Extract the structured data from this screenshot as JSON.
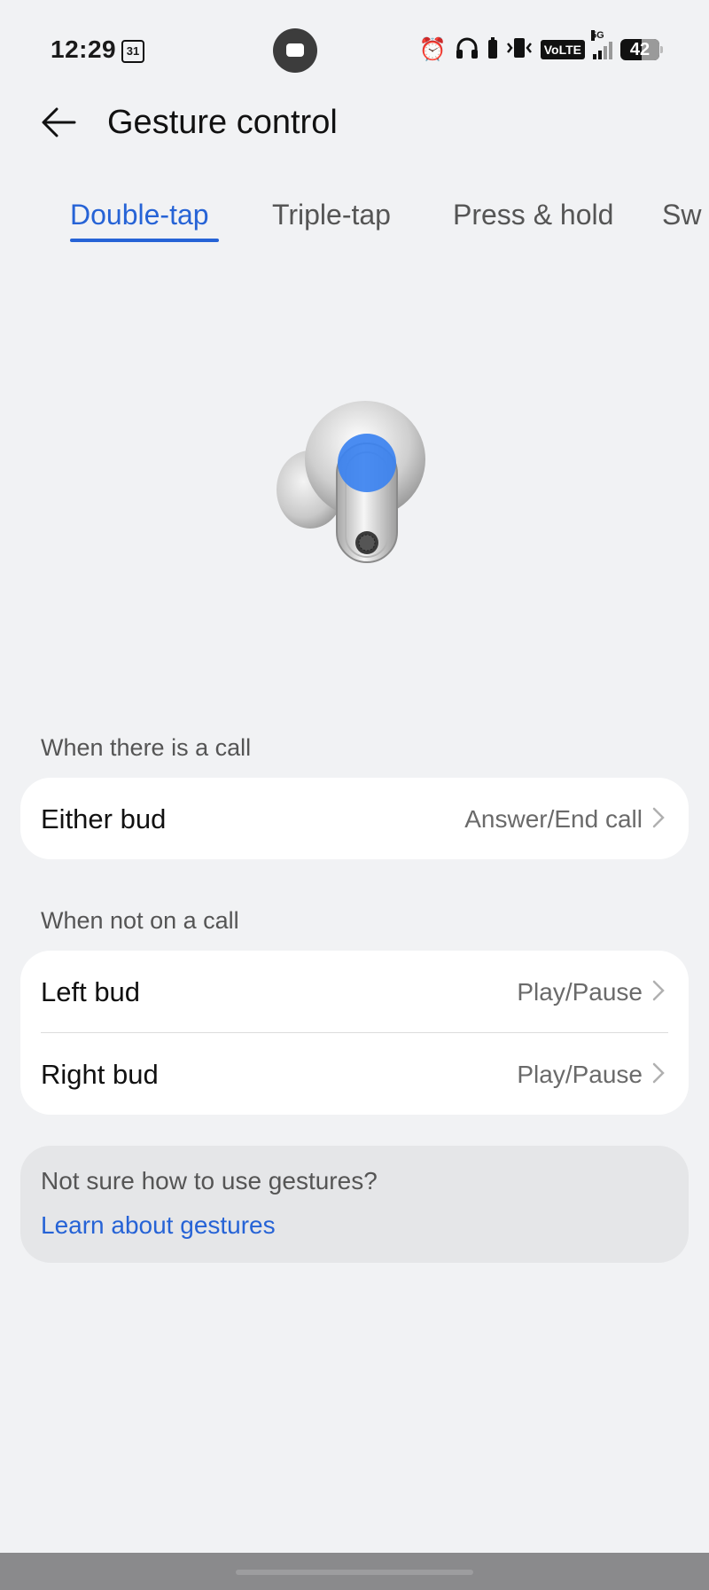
{
  "status_bar": {
    "time": "12:29",
    "calendar_day": "31",
    "network": "5G",
    "volte": "VoLTE",
    "battery": "42",
    "icons": [
      "alarm-icon",
      "headphones-icon",
      "vibrate-icon",
      "volte-icon",
      "signal-icon",
      "battery-icon"
    ]
  },
  "header": {
    "title": "Gesture control"
  },
  "tabs": [
    {
      "label": "Double-tap",
      "active": true
    },
    {
      "label": "Triple-tap",
      "active": false
    },
    {
      "label": "Press & hold",
      "active": false
    },
    {
      "label": "Sw",
      "active": false
    }
  ],
  "sections": {
    "call": {
      "label": "When there is a call",
      "rows": [
        {
          "label": "Either bud",
          "value": "Answer/End call"
        }
      ]
    },
    "no_call": {
      "label": "When not on a call",
      "rows": [
        {
          "label": "Left bud",
          "value": "Play/Pause"
        },
        {
          "label": "Right bud",
          "value": "Play/Pause"
        }
      ]
    }
  },
  "help": {
    "question": "Not sure how to use gestures?",
    "link": "Learn about gestures"
  },
  "colors": {
    "accent": "#2663d6",
    "background": "#f1f2f4",
    "card": "#ffffff"
  }
}
